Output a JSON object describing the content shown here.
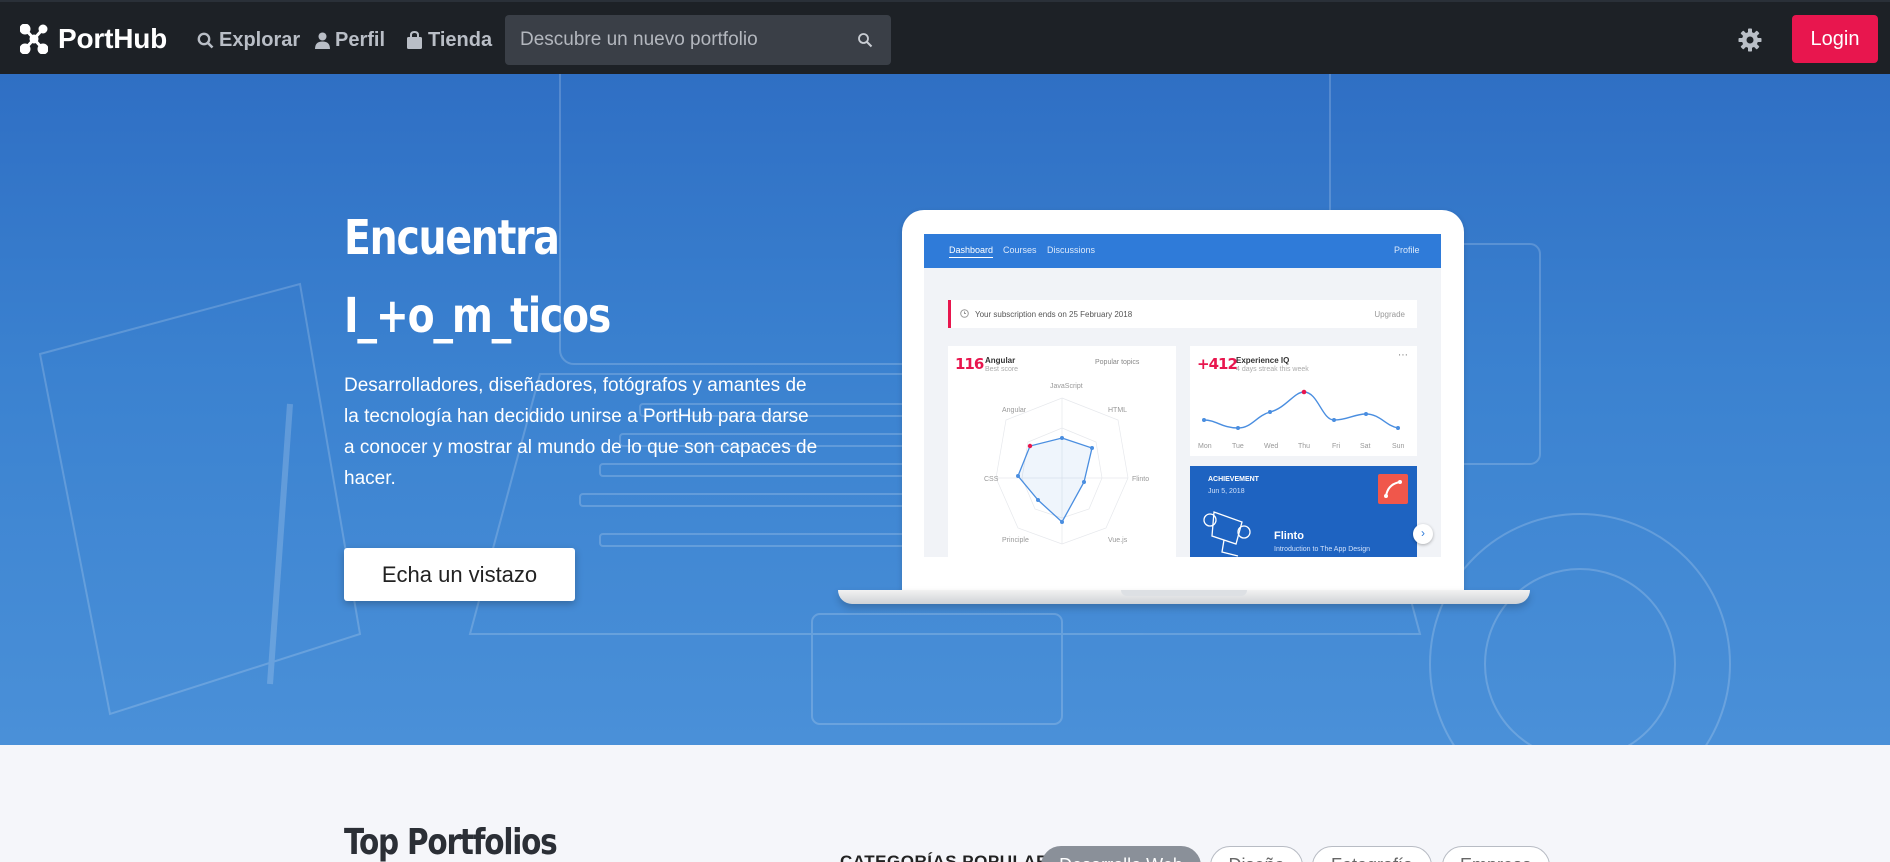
{
  "navbar": {
    "brand": "PortHub",
    "links": [
      {
        "label": "Explorar",
        "icon": "search-icon"
      },
      {
        "label": "Perfil",
        "icon": "user-icon"
      },
      {
        "label": "Tienda",
        "icon": "shopping-bag-icon"
      }
    ],
    "search": {
      "placeholder": "Descubre un nuevo portfolio",
      "value": ""
    },
    "settings_icon": "gear-icon",
    "login_label": "Login"
  },
  "hero": {
    "title_line1": "Encuentra",
    "title_line2": "I_+o_m_ticos",
    "description": "Desarrolladores, diseñadores, fotógrafos y amantes de la tecnología han decidido unirse a PortHub para darse a conocer y mostrar al mundo de lo que son capaces de hacer.",
    "cta_label": "Echa un vistazo",
    "colors": {
      "accent": "#e8164e",
      "hero_blue": "#3b82d0",
      "navbar": "#1d2126"
    }
  },
  "mockup": {
    "tabs": [
      "Dashboard",
      "Courses",
      "Discussions"
    ],
    "profile": "Profile",
    "subscription_text": "Your subscription ends on 25 February 2018",
    "upgrade_label": "Upgrade",
    "card1": {
      "value": "116",
      "title": "Angular",
      "subtitle": "Best score",
      "dropdown": "Popular topics"
    },
    "radar_labels": [
      "JavaScript",
      "HTML",
      "Flinto",
      "Vue.js",
      "Principle",
      "CSS",
      "Angular"
    ],
    "card2": {
      "value": "+412",
      "title": "Experience IQ",
      "subtitle": "4 days streak this week"
    },
    "days": [
      "Mon",
      "Tue",
      "Wed",
      "Thu",
      "Fri",
      "Sat",
      "Sun"
    ],
    "achievement": {
      "heading": "ACHIEVEMENT",
      "date": "Jun 5, 2018",
      "name": "Flinto",
      "subtitle": "Introduction to The App Design"
    }
  },
  "section": {
    "title": "Top Portfolios",
    "categories_label": "CATEGORÍAS POPULARES",
    "categories": [
      {
        "label": "Desarrollo Web",
        "active": true
      },
      {
        "label": "Diseño",
        "active": false
      },
      {
        "label": "Fotografía",
        "active": false
      },
      {
        "label": "Empresa",
        "active": false
      }
    ]
  }
}
